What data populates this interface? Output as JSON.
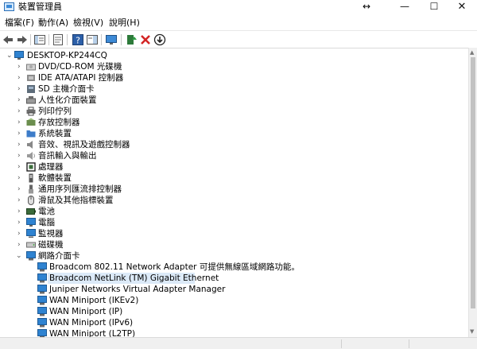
{
  "window": {
    "title": "裝置管理員",
    "resize_glyph": "↔",
    "min_glyph": "—",
    "max_glyph": "☐",
    "close_glyph": "✕"
  },
  "menu": [
    "檔案(F)",
    "動作(A)",
    "檢視(V)",
    "說明(H)"
  ],
  "toolbar": [
    "back-arrow-icon",
    "forward-arrow-icon",
    "show-hide-tree-icon",
    "properties-icon",
    "help-icon",
    "action-pane-icon",
    "monitor-icon",
    "update-driver-icon",
    "uninstall-icon",
    "disable-device-icon"
  ],
  "tree": {
    "root": "DESKTOP-KP244CQ",
    "categories": [
      {
        "label": "DVD/CD-ROM 光碟機",
        "icon": "dvd-drive-icon",
        "color": "#7a7a7a"
      },
      {
        "label": "IDE ATA/ATAPI 控制器",
        "icon": "ide-controller-icon",
        "color": "#6e6e6e"
      },
      {
        "label": "SD 主機介面卡",
        "icon": "sd-card-icon",
        "color": "#5d6c7a"
      },
      {
        "label": "人性化介面裝置",
        "icon": "hid-icon",
        "color": "#6a6a6a"
      },
      {
        "label": "列印佇列",
        "icon": "printer-icon",
        "color": "#4a4a4a"
      },
      {
        "label": "存放控制器",
        "icon": "storage-controller-icon",
        "color": "#6b8e4e"
      },
      {
        "label": "系統裝置",
        "icon": "system-folder-icon",
        "color": "#3d7cc9"
      },
      {
        "label": "音效、視訊及遊戲控制器",
        "icon": "speaker-icon",
        "color": "#888888"
      },
      {
        "label": "音訊輸入與輸出",
        "icon": "audio-io-icon",
        "color": "#888888"
      },
      {
        "label": "處理器",
        "icon": "processor-icon",
        "color": "#3c6e3c"
      },
      {
        "label": "軟體裝置",
        "icon": "software-device-icon",
        "color": "#555555"
      },
      {
        "label": "通用序列匯流排控制器",
        "icon": "usb-icon",
        "color": "#555555"
      },
      {
        "label": "滑鼠及其他指標裝置",
        "icon": "mouse-icon",
        "color": "#777777"
      },
      {
        "label": "電池",
        "icon": "battery-icon",
        "color": "#3a6a3a"
      },
      {
        "label": "電腦",
        "icon": "computer-icon",
        "color": "#2f83d1"
      },
      {
        "label": "監視器",
        "icon": "display-icon",
        "color": "#2f83d1"
      },
      {
        "label": "磁碟機",
        "icon": "disk-drive-icon",
        "color": "#707070"
      }
    ],
    "network": {
      "label": "網路介面卡",
      "icon": "network-adapter-icon",
      "children": [
        "Broadcom 802.11 Network Adapter 可提供無線區域網路功能。",
        "Broadcom NetLink (TM) Gigabit Ethernet",
        "Juniper Networks Virtual Adapter Manager",
        "WAN Miniport (IKEv2)",
        "WAN Miniport (IP)",
        "WAN Miniport (IPv6)",
        "WAN Miniport (L2TP)"
      ],
      "selected_index": 1
    }
  },
  "colors": {
    "selection": "#dceaf8",
    "network_icon": "#2f83d1"
  }
}
